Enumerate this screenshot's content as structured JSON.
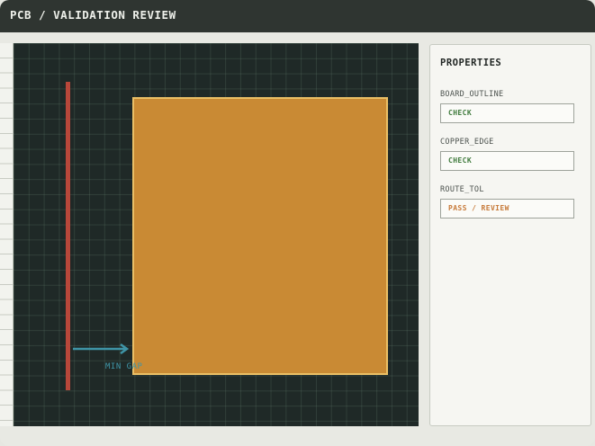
{
  "window": {
    "title": "PCB / VALIDATION REVIEW"
  },
  "canvas": {
    "gap_label": "MIN GAP",
    "colors": {
      "background": "#1f2927",
      "board_fill": "#c98a34",
      "board_outline": "#eabf66",
      "edge_line": "#b8473a",
      "gap_arrow": "#3f95a7"
    }
  },
  "properties": {
    "title": "PROPERTIES",
    "items": [
      {
        "label": "BOARD_OUTLINE",
        "value": "CHECK",
        "status": "ok"
      },
      {
        "label": "COPPER_EDGE",
        "value": "CHECK",
        "status": "ok"
      },
      {
        "label": "ROUTE_TOL",
        "value": "PASS / REVIEW",
        "status": "review"
      }
    ]
  }
}
